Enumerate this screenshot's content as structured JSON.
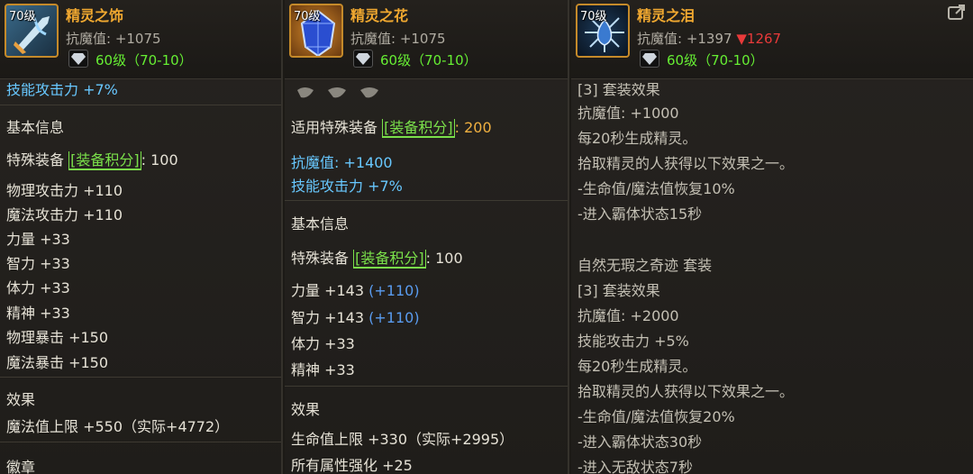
{
  "panels": [
    {
      "level": "70级",
      "name": "精灵之饰",
      "resist": "抗魔值: +1075",
      "gem_text": "60级（70-10）",
      "top_cut_text": "技能攻击力 +7%",
      "section_basic": "基本信息",
      "special_label": "特殊装备",
      "special_tag": "[装备积分]",
      "special_value": ": 100",
      "stats": [
        "物理攻击力 +110",
        "魔法攻击力 +110",
        "力量 +33",
        "智力 +33",
        "体力 +33",
        "精神 +33",
        "物理暴击 +150",
        "魔法暴击 +150"
      ],
      "section_effect": "效果",
      "effect_line": "魔法值上限 +550（实际+4772）",
      "section_badge": "徽章"
    },
    {
      "level": "70级",
      "name": "精灵之花",
      "resist": "抗魔值: +1075",
      "gem_text": "60级（70-10）",
      "applicable_label": "适用特殊装备",
      "applicable_tag": "[装备积分]",
      "applicable_value": ": 200",
      "resist_line": "抗魔值: +1400",
      "skill_line": "技能攻击力 +7%",
      "section_basic": "基本信息",
      "special_label": "特殊装备",
      "special_tag": "[装备积分]",
      "special_value": ": 100",
      "str_line": "力量 +143",
      "str_bonus": "(+110)",
      "int_line": "智力 +143",
      "int_bonus": "(+110)",
      "vit_line": "体力 +33",
      "spi_line": "精神 +33",
      "section_effect": "效果",
      "hp_line": "生命值上限 +330（实际+2995）",
      "all_line": "所有属性强化 +25"
    },
    {
      "level": "70级",
      "name": "精灵之泪",
      "resist": "抗魔值: +1397",
      "resist_diff": "▼1267",
      "gem_text": "60级（70-10）",
      "top_cut_text": "[3] 套装效果",
      "set1": [
        "抗魔值: +1000",
        "每20秒生成精灵。",
        "拾取精灵的人获得以下效果之一。",
        "-生命值/魔法值恢复10%",
        "-进入霸体状态15秒"
      ],
      "set2_title": "自然无瑕之奇迹  套装",
      "set2": [
        "[3] 套装效果",
        "抗魔值: +2000",
        "技能攻击力 +5%",
        "每20秒生成精灵。",
        "拾取精灵的人获得以下效果之一。",
        "-生命值/魔法值恢复20%",
        "-进入霸体状态30秒",
        "-进入无敌状态7秒"
      ]
    }
  ],
  "colors": {
    "name": "#f0a830",
    "gem_level": "#66ee33",
    "blue_stat": "#68c8ff",
    "down_arrow": "#e83a3a",
    "tag": "#7ae04a"
  },
  "icons": [
    "sword-icon",
    "sapphire-icon",
    "tear-gem-icon",
    "gem-socket-icon",
    "export-icon"
  ]
}
